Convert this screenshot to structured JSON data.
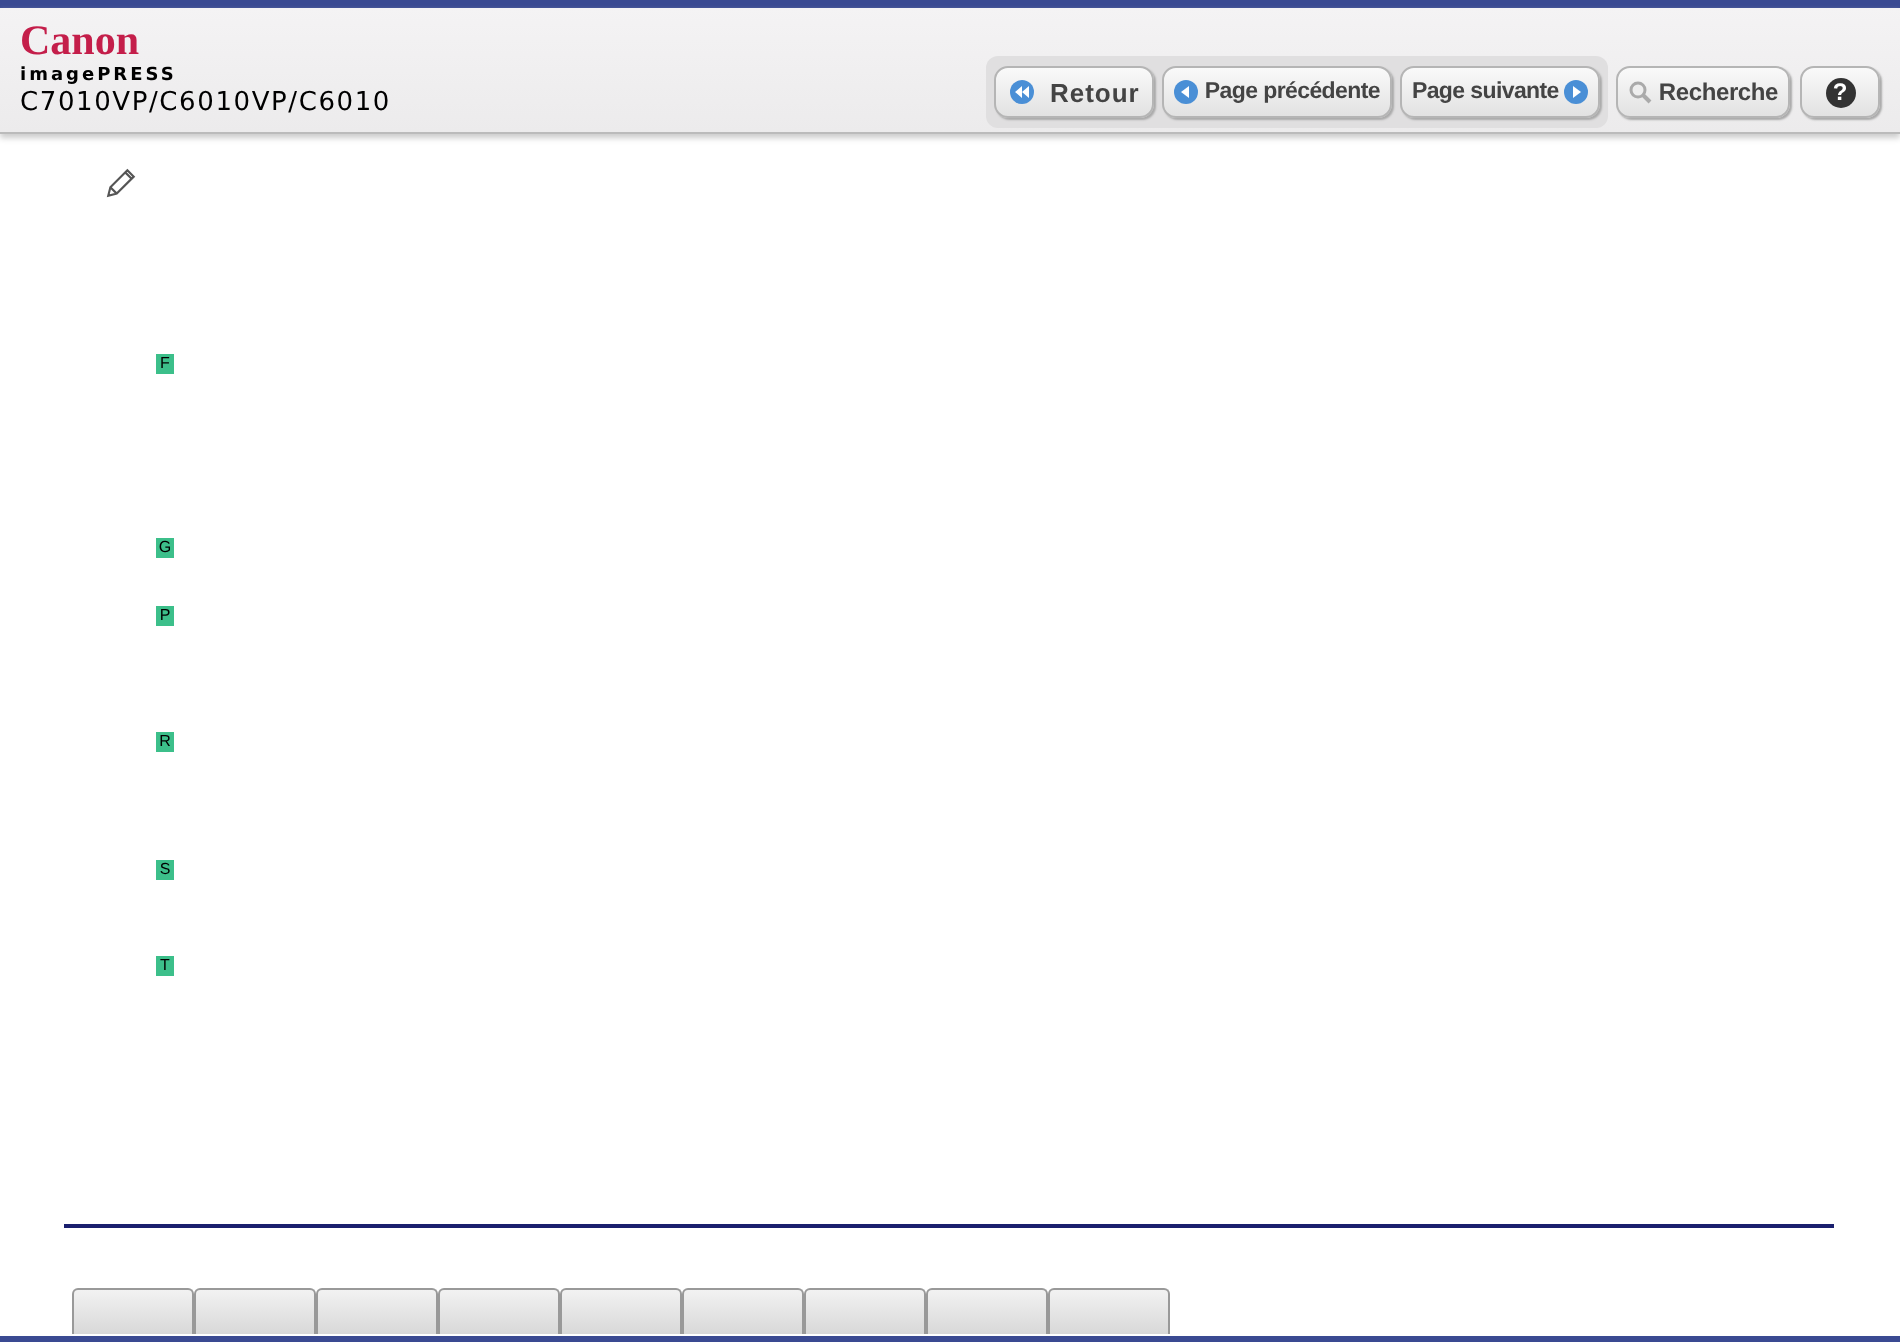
{
  "header": {
    "brand": "Canon",
    "product_line": "imagePRESS",
    "model": "C7010VP/C6010VP/C6010"
  },
  "nav_buttons": [
    {
      "kind": "back",
      "label": "Retour"
    },
    {
      "kind": "prev",
      "label": "Page précédente"
    },
    {
      "kind": "next",
      "label": "Page suivante"
    },
    {
      "kind": "search",
      "label": "Recherche"
    },
    {
      "kind": "help",
      "label": "?"
    }
  ],
  "markers": [
    {
      "letter": "F"
    },
    {
      "letter": "G"
    },
    {
      "letter": "P"
    },
    {
      "letter": "R"
    },
    {
      "letter": "S"
    },
    {
      "letter": "T"
    }
  ],
  "footer_tabs": [
    {
      "kind": "tab"
    },
    {
      "kind": "tab"
    },
    {
      "kind": "tab"
    },
    {
      "kind": "tab"
    },
    {
      "kind": "tab"
    },
    {
      "kind": "tab"
    },
    {
      "kind": "tab"
    },
    {
      "kind": "tab"
    },
    {
      "kind": "tab"
    }
  ]
}
